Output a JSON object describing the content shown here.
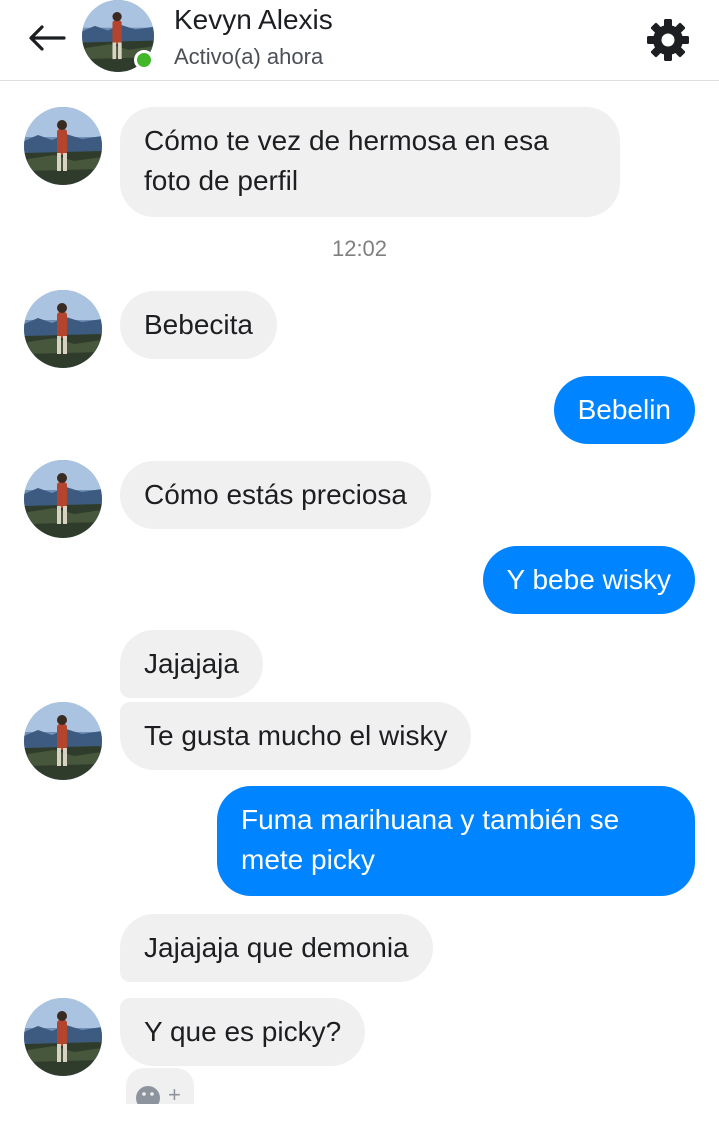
{
  "header": {
    "contact_name": "Kevyn Alexis",
    "status": "Activo(a) ahora",
    "back_icon": "arrow-left-icon",
    "settings_icon": "gear-icon",
    "online_color": "#42b72a"
  },
  "conversation": {
    "timestamp": "12:02",
    "messages": [
      {
        "from": "them",
        "text_lines": [
          "Cómo te vez de hermosa en esa",
          "foto de perfil"
        ]
      },
      {
        "from": "them",
        "text": "Bebecita"
      },
      {
        "from": "me",
        "text": "Bebelin"
      },
      {
        "from": "them",
        "text": "Cómo estás preciosa"
      },
      {
        "from": "me",
        "text": "Y bebe wisky"
      },
      {
        "from": "them",
        "text": "Jajajaja"
      },
      {
        "from": "them",
        "text": "Te gusta mucho el wisky"
      },
      {
        "from": "me",
        "text_lines": [
          "Fuma marihuana y también se",
          "mete picky"
        ]
      },
      {
        "from": "them",
        "text": "Jajajaja que demonia"
      },
      {
        "from": "them",
        "text": "Y que es picky?"
      }
    ]
  },
  "composer": {
    "icon": "emoji-add-icon",
    "plus": "+"
  },
  "colors": {
    "outgoing": "#0084ff",
    "incoming": "#f1f0f0"
  }
}
